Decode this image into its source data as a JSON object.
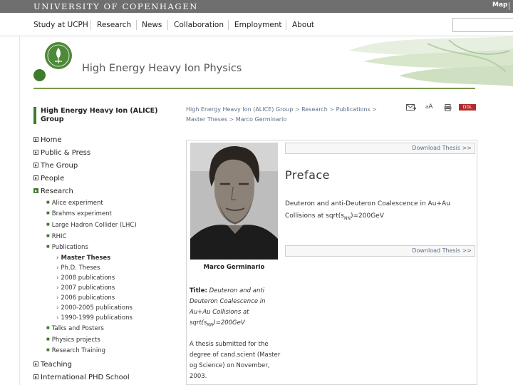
{
  "topbar": {
    "university": "UNIVERSITY OF COPENHAGEN",
    "map_label": "Map"
  },
  "nav": {
    "items": [
      "Study at UCPH",
      "Research",
      "News",
      "Collaboration",
      "Employment",
      "About"
    ]
  },
  "search": {
    "placeholder": ""
  },
  "header": {
    "site_title": "High Energy Heavy Ion Physics"
  },
  "sidebar": {
    "group_title": "High Energy Heavy Ion (ALICE) Group",
    "items": [
      "Home",
      "Public & Press",
      "The Group",
      "People",
      "Research",
      "Teaching",
      "International PHD School"
    ],
    "research_sub": [
      "Alice experiment",
      "Brahms experiment",
      "Large Hadron Collider (LHC)",
      "RHIC",
      "Publications",
      "Talks and Posters",
      "Physics projects",
      "Research Training"
    ],
    "publications_sub": [
      "Master Theses",
      "Ph.D. Theses",
      "2008 publications",
      "2007 publications",
      "2006 publications",
      "2000-2005 publications",
      "1990-1999 publications"
    ]
  },
  "breadcrumb": {
    "items": [
      "High Energy Heavy Ion (ALICE) Group",
      "Research",
      "Publications",
      "Master Theses"
    ],
    "current": "Marco Germinario",
    "separator": ">"
  },
  "tools": {
    "font_label": "A",
    "ddl_label": "DDL"
  },
  "content": {
    "person_name": "Marco Germinario",
    "title_label": "Title:",
    "title_pre": "Deuteron and anti Deuteron Coalescence in Au+Au Collisions at sqrt(s",
    "title_sub": "NN",
    "title_post": ")=200GeV",
    "description": "A thesis submitted for the degree of cand.scient (Master og Science) on November, 2003.",
    "download_label": "Download Thesis >>",
    "heading": "Preface",
    "abstract_pre": "Deuteron and anti-Deuteron Coalescence in Au+Au Collisions at sqrt(s",
    "abstract_sub": "NN",
    "abstract_post": ")=200GeV"
  },
  "colors": {
    "accent_green": "#3f7a2e",
    "topbar_gray": "#6f6f6f",
    "link_blue": "#5b6f87",
    "ddl_red": "#b42a2a"
  },
  "icons": [
    "email-icon",
    "font-size-icon",
    "print-icon",
    "ddl-icon",
    "university-logo"
  ]
}
